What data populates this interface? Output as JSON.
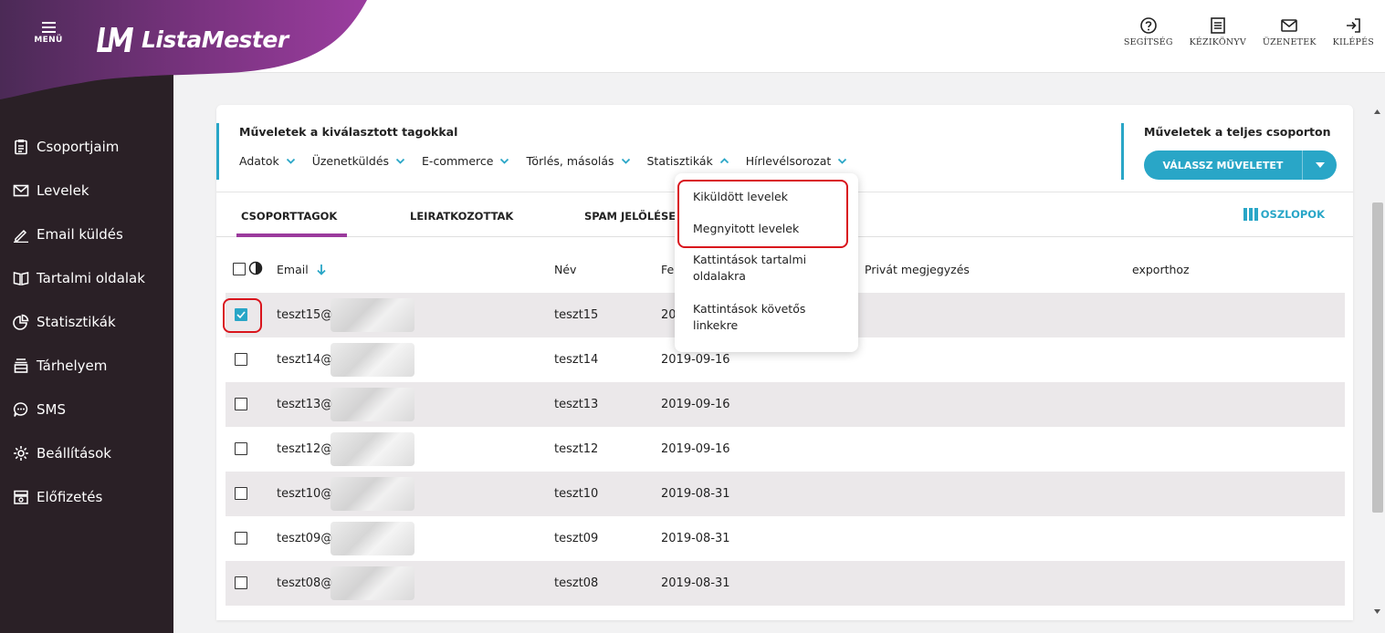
{
  "brand": {
    "menu_label": "MENÜ",
    "logo_text": "ListaMester"
  },
  "top_actions": [
    {
      "label": "SEGÍTSÉG",
      "icon": "help-icon"
    },
    {
      "label": "KÉZIKÖNYV",
      "icon": "manual-icon"
    },
    {
      "label": "ÜZENETEK",
      "icon": "messages-icon"
    },
    {
      "label": "KILÉPÉS",
      "icon": "logout-icon"
    }
  ],
  "sidebar": {
    "items": [
      {
        "label": "Csoportjaim",
        "icon": "clipboard-icon"
      },
      {
        "label": "Levelek",
        "icon": "envelope-icon"
      },
      {
        "label": "Email küldés",
        "icon": "pencil-icon"
      },
      {
        "label": "Tartalmi oldalak",
        "icon": "book-icon"
      },
      {
        "label": "Statisztikák",
        "icon": "pie-chart-icon"
      },
      {
        "label": "Tárhelyem",
        "icon": "storage-icon"
      },
      {
        "label": "SMS",
        "icon": "chat-bubble-icon"
      },
      {
        "label": "Beállítások",
        "icon": "gear-icon"
      },
      {
        "label": "Előfizetés",
        "icon": "subscription-icon"
      }
    ]
  },
  "operations": {
    "title": "Műveletek a kiválasztott tagokkal",
    "items": [
      {
        "label": "Adatok",
        "open": false
      },
      {
        "label": "Üzenetküldés",
        "open": false
      },
      {
        "label": "E-commerce",
        "open": false
      },
      {
        "label": "Törlés, másolás",
        "open": false
      },
      {
        "label": "Statisztikák",
        "open": true
      },
      {
        "label": "Hírlevélsorozat",
        "open": false
      }
    ]
  },
  "group_ops": {
    "title": "Műveletek a teljes csoporton",
    "button_label": "VÁLASSZ MŰVELETET"
  },
  "tabs": {
    "items": [
      "CSOPORTTAGOK",
      "LEIRATKOZOTTAK",
      "SPAM JELÖLÉSE"
    ],
    "active": "CSOPORTTAGOK",
    "columns_label": "OSZLOPOK"
  },
  "table": {
    "headers": {
      "email": "Email",
      "name": "Név",
      "date": "Fe",
      "private_note": "Privát megjegyzés",
      "export": "exporthoz"
    },
    "rows": [
      {
        "email": "teszt15@",
        "name": "teszt15",
        "date": "20",
        "checked": true
      },
      {
        "email": "teszt14@",
        "name": "teszt14",
        "date": "2019-09-16",
        "checked": false
      },
      {
        "email": "teszt13@",
        "name": "teszt13",
        "date": "2019-09-16",
        "checked": false
      },
      {
        "email": "teszt12@",
        "name": "teszt12",
        "date": "2019-09-16",
        "checked": false
      },
      {
        "email": "teszt10@",
        "name": "teszt10",
        "date": "2019-08-31",
        "checked": false
      },
      {
        "email": "teszt09@",
        "name": "teszt09",
        "date": "2019-08-31",
        "checked": false
      },
      {
        "email": "teszt08@",
        "name": "teszt08",
        "date": "2019-08-31",
        "checked": false
      }
    ]
  },
  "statistics_menu": {
    "items": [
      {
        "label": "Kiküldött levelek"
      },
      {
        "label": "Megnyitott levelek"
      },
      {
        "label": "Kattintások tartalmi oldalakra"
      },
      {
        "label": "Kattintások követős linkekre"
      }
    ]
  },
  "colors": {
    "accent": "#29a6c7",
    "brand_purple": "#9b3a9d",
    "sidebar_bg": "#2a2026",
    "highlight": "#d9141c"
  }
}
